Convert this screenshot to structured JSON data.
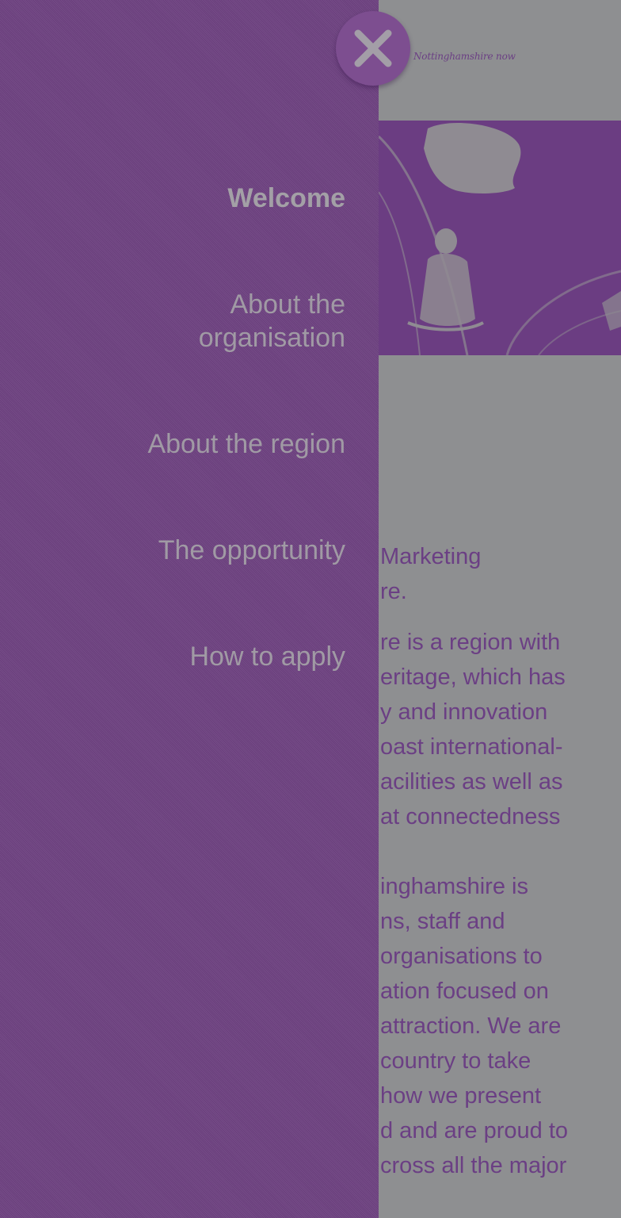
{
  "header": {
    "logo_text": "Nottinghamshire now"
  },
  "nav": {
    "close_icon": "close-icon",
    "items": [
      {
        "label": "Welcome",
        "active": true
      },
      {
        "label": "About the organisation",
        "active": false
      },
      {
        "label": "About the region",
        "active": false
      },
      {
        "label": "The opportunity",
        "active": false
      },
      {
        "label": "How to apply",
        "active": false
      }
    ]
  },
  "content": {
    "para1": [
      "Marketing",
      "re."
    ],
    "para2": [
      "re is a region with",
      "eritage, which has",
      "y and innovation",
      "oast international-",
      "acilities as well as",
      "at connectedness"
    ],
    "para3": [
      "inghamshire is",
      "ns, staff and",
      "organisations to",
      "ation focused on",
      "attraction. We are",
      "country to take",
      "how we present",
      "d and are proud to",
      "cross all the major"
    ]
  },
  "colors": {
    "drawer": "#6e4281",
    "nav_text": "#a09aa4",
    "page_bg": "#8e8f91",
    "accent": "#6b3f84"
  }
}
